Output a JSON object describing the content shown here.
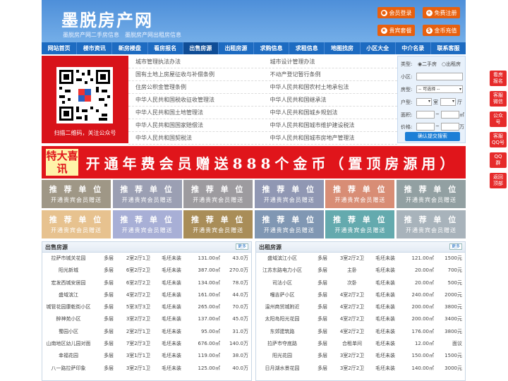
{
  "header": {
    "logo": "墨脱房产网",
    "slogan": "墨脱房产网二手房信息　墨脱房产网出租房信息",
    "buttons": [
      {
        "label": "会员登录",
        "icon": "user-icon"
      },
      {
        "label": "免费注册",
        "icon": "user-plus-icon"
      },
      {
        "label": "贵宾套餐",
        "icon": "star-icon"
      },
      {
        "label": "金币充值",
        "icon": "coin-icon"
      }
    ]
  },
  "nav": [
    "网站首页",
    "楼市资讯",
    "新房楼盘",
    "看房报名",
    "出售房源",
    "出租房源",
    "求购信息",
    "求租信息",
    "地图找房",
    "小区大全",
    "中介名录",
    "联系客服"
  ],
  "qr": {
    "caption": "扫描二维码，关注公众号"
  },
  "laws": [
    [
      "城市管理执法办法",
      "城市设计管理办法"
    ],
    [
      "国有土地上房屋征收与补偿条例",
      "不动产登记暂行条例"
    ],
    [
      "住房公积金管理条例",
      "中华人民共和国农村土地承包法"
    ],
    [
      "中华人民共和国税收征收管理法",
      "中华人民共和国继承法"
    ],
    [
      "中华人民共和国土地管理法",
      "中华人民共和国城乡规划法"
    ],
    [
      "中华人民共和国国家赔偿法",
      "中华人民共和国城市维护建设税法"
    ],
    [
      "中华人民共和国契税法",
      "中华人民共和国城市房地产管理法"
    ]
  ],
  "search": {
    "type_label": "类型:",
    "opt1": "二手房",
    "opt2": "出租房",
    "community_label": "小区:",
    "house_type_label": "房型:",
    "select_value": "-- 可选择 --",
    "layout_label": "户型:",
    "room": "室",
    "hall": "厅",
    "area_label": "面积:",
    "area_unit": "㎡",
    "price_label": "价格:",
    "price_unit": "万",
    "submit": "确认提交搜索"
  },
  "banner": {
    "tag": "特大喜讯",
    "text": "开通年费会员赠送888个金币（置顶房源用）"
  },
  "ads": {
    "line1": "推 荐 单 位",
    "line2": "开通贵宾会员赠送",
    "colors": [
      "#8f8672",
      "#8a8fa6",
      "#8d8a8f",
      "#7d86a6",
      "#d27a5e",
      "#7f9092",
      "#e3b87c",
      "#9aa2d0",
      "#9b7a3b",
      "#6b86a6",
      "#4a9ca0",
      "#9aa6b0"
    ]
  },
  "sale": {
    "title": "出售房源",
    "more": "更多",
    "rows": [
      [
        "拉萨市城关花园",
        "多层",
        "2室2厅1卫",
        "毛坯未装",
        "131.00㎡",
        "43.0万"
      ],
      [
        "阳光新城",
        "多层",
        "6室2厅2卫",
        "毛坯未装",
        "387.00㎡",
        "270.0万"
      ],
      [
        "宏发西城安居园",
        "多层",
        "6室2厅2卫",
        "毛坯未装",
        "134.00㎡",
        "78.0万"
      ],
      [
        "盛域滨江",
        "多层",
        "4室2厅2卫",
        "毛坯未装",
        "161.00㎡",
        "44.0万"
      ],
      [
        "城管花园康乾街小区",
        "多层",
        "5室3厅3卫",
        "毛坯未装",
        "265.00㎡",
        "70.0万"
      ],
      [
        "醉神苑小区",
        "多层",
        "3室2厅2卫",
        "毛坯未装",
        "137.00㎡",
        "45.0万"
      ],
      [
        "蜀园小区",
        "多层",
        "2室2厅1卫",
        "毛坯未装",
        "95.00㎡",
        "31.0万"
      ],
      [
        "山南地区幼儿园对面",
        "多层",
        "7室2厅3卫",
        "毛坯未装",
        "676.00㎡",
        "140.0万"
      ],
      [
        "幸福花园",
        "多层",
        "3室1厅1卫",
        "毛坯未装",
        "119.00㎡",
        "38.0万"
      ],
      [
        "八一路拉萨印象",
        "多层",
        "3室2厅1卫",
        "毛坯未装",
        "125.00㎡",
        "40.0万"
      ]
    ]
  },
  "rent": {
    "title": "出租房源",
    "more": "更多",
    "rows": [
      [
        "盛域滨江小区",
        "多层",
        "3室2厅2卫",
        "毛坯未装",
        "121.00㎡",
        "1500元"
      ],
      [
        "江苏东路电力小区",
        "多层",
        "主卧",
        "毛坯未装",
        "20.00㎡",
        "700元"
      ],
      [
        "司法小区",
        "多层",
        "次卧",
        "毛坯未装",
        "20.00㎡",
        "500元"
      ],
      [
        "嘎吉萨小区",
        "多层",
        "4室2厅2卫",
        "毛坯未装",
        "240.00㎡",
        "2000元"
      ],
      [
        "温州商贸城附近",
        "多层",
        "4室2厅2卫",
        "毛坯未装",
        "200.00㎡",
        "3800元"
      ],
      [
        "太阳岛阳光花园",
        "多层",
        "4室2厅2卫",
        "毛坯未装",
        "200.00㎡",
        "3400元"
      ],
      [
        "东郊建筑路",
        "多层",
        "4室2厅2卫",
        "毛坯未装",
        "176.00㎡",
        "3800元"
      ],
      [
        "拉萨市夺底路",
        "多层",
        "合租单间",
        "毛坯未装",
        "12.00㎡",
        "面议"
      ],
      [
        "阳光花园",
        "多层",
        "3室2厅2卫",
        "毛坯未装",
        "150.00㎡",
        "1500元"
      ],
      [
        "日月湖水景花园",
        "多层",
        "3室2厅2卫",
        "毛坯未装",
        "140.00㎡",
        "3000元"
      ]
    ]
  },
  "side": [
    [
      "看房",
      "报名"
    ],
    [
      "客服",
      "微信"
    ],
    [
      "公众",
      "号"
    ],
    [
      "客服",
      "QQ号"
    ],
    [
      "QQ",
      "群"
    ],
    [
      "返回",
      "顶部"
    ]
  ]
}
